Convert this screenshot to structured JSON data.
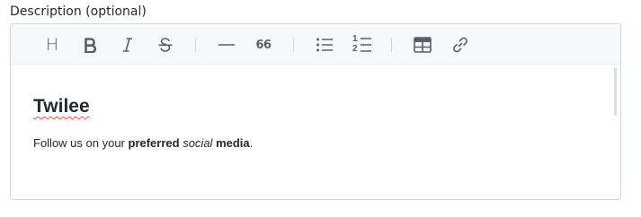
{
  "field": {
    "label": "Description (optional)"
  },
  "toolbar": {
    "buttons": [
      {
        "name": "heading",
        "icon": "heading-icon",
        "glyph": "H"
      },
      {
        "name": "bold",
        "icon": "bold-icon"
      },
      {
        "name": "italic",
        "icon": "italic-icon"
      },
      {
        "name": "strikethrough",
        "icon": "strikethrough-icon"
      },
      {
        "name": "horizontal-rule",
        "icon": "horizontal-rule-icon"
      },
      {
        "name": "blockquote",
        "icon": "quote-icon",
        "glyph": "66"
      },
      {
        "name": "bullet-list",
        "icon": "bullet-list-icon"
      },
      {
        "name": "ordered-list",
        "icon": "ordered-list-icon",
        "glyph_1": "1",
        "glyph_2": "2"
      },
      {
        "name": "table",
        "icon": "table-icon"
      },
      {
        "name": "link",
        "icon": "link-icon"
      }
    ]
  },
  "content": {
    "heading": "Twilee",
    "paragraph": {
      "part1": "Follow us on your ",
      "bold1": "preferred",
      "space1": " ",
      "italic1": "social",
      "space2": " ",
      "bold2": "media",
      "end": "."
    }
  },
  "colors": {
    "toolbar_bg": "#f6f8fa",
    "border": "#d0d7de",
    "icon": "#57606a",
    "text": "#24292f",
    "spellcheck": "#e5534b"
  }
}
